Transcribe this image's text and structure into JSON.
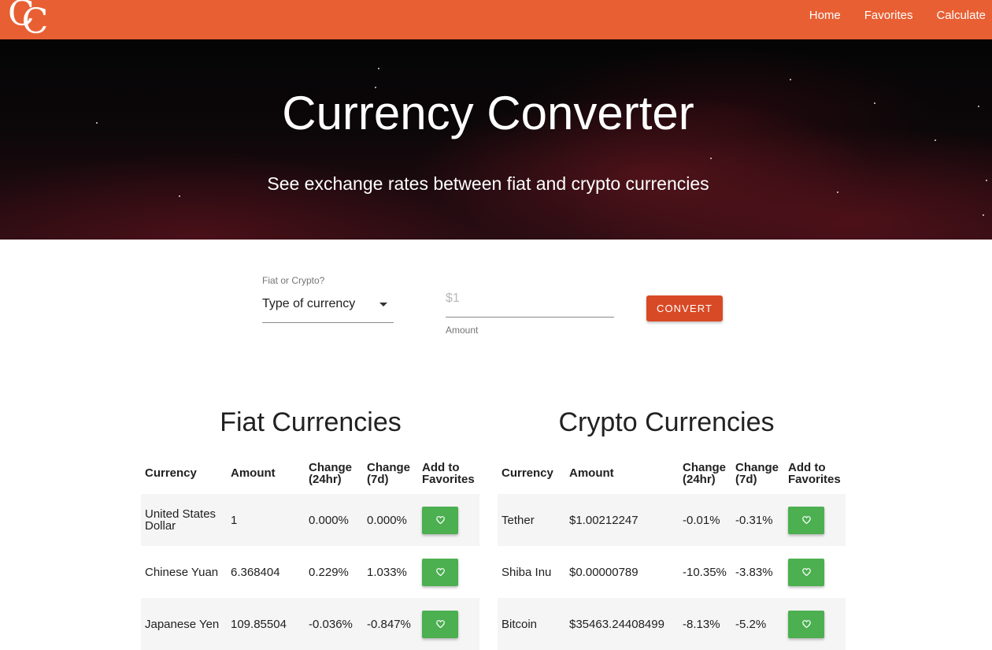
{
  "nav": {
    "logo": "CC",
    "links": [
      "Home",
      "Favorites",
      "Calculate"
    ]
  },
  "hero": {
    "title": "Currency Converter",
    "subtitle": "See exchange rates between fiat and crypto currencies"
  },
  "converter": {
    "select_label": "Fiat or Crypto?",
    "select_value": "Type of currency",
    "amount_placeholder": "$1",
    "amount_helper": "Amount",
    "convert_label": "CONVERT"
  },
  "fiat": {
    "title": "Fiat Currencies",
    "headers": [
      "Currency",
      "Amount",
      "Change (24hr)",
      "Change (7d)",
      "Add to Favorites"
    ],
    "rows": [
      {
        "currency": "United States Dollar",
        "amount": "1",
        "change24": "0.000%",
        "change7": "0.000%"
      },
      {
        "currency": "Chinese Yuan",
        "amount": "6.368404",
        "change24": "0.229%",
        "change7": "1.033%"
      },
      {
        "currency": "Japanese Yen",
        "amount": "109.85504",
        "change24": "-0.036%",
        "change7": "-0.847%"
      }
    ]
  },
  "crypto": {
    "title": "Crypto Currencies",
    "headers": [
      "Currency",
      "Amount",
      "Change (24hr)",
      "Change (7d)",
      "Add to Favorites"
    ],
    "rows": [
      {
        "currency": "Tether",
        "amount": "$1.00212247",
        "change24": "-0.01%",
        "change7": "-0.31%"
      },
      {
        "currency": "Shiba Inu",
        "amount": "$0.00000789",
        "change24": "-10.35%",
        "change7": "-3.83%"
      },
      {
        "currency": "Bitcoin",
        "amount": "$35463.24408499",
        "change24": "-8.13%",
        "change7": "-5.2%"
      }
    ]
  },
  "colors": {
    "nav_bg": "#e85f33",
    "convert_btn": "#d84a26",
    "favorite_btn": "#4caf50"
  },
  "icons": {
    "favorite": "heart-outline-icon"
  }
}
